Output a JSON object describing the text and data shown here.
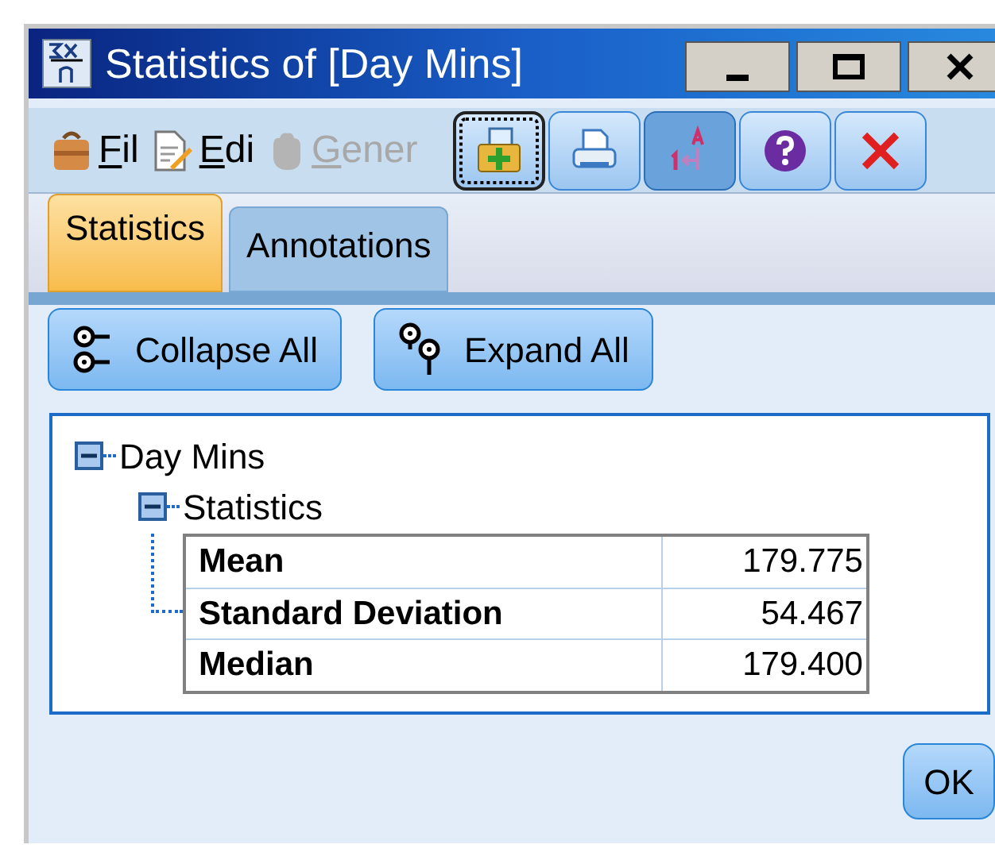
{
  "window": {
    "title": "Statistics of [Day Mins]",
    "controls": [
      {
        "kind": "minimize"
      },
      {
        "kind": "maximize"
      },
      {
        "kind": "close"
      }
    ]
  },
  "menu": [
    {
      "label": "Fil",
      "kind": "bag",
      "disabled": false
    },
    {
      "label": "Edi",
      "kind": "page",
      "disabled": false
    },
    {
      "label": "Gener",
      "kind": "hand",
      "disabled": true
    }
  ],
  "toolbar": [
    {
      "kind": "add",
      "focused": true,
      "pressed": false
    },
    {
      "kind": "print",
      "focused": false,
      "pressed": false
    },
    {
      "kind": "sort",
      "focused": false,
      "pressed": true
    },
    {
      "kind": "help",
      "focused": false,
      "pressed": false
    },
    {
      "kind": "delete",
      "focused": false,
      "pressed": false
    }
  ],
  "tabs": [
    {
      "label": "Statistics",
      "selected": true
    },
    {
      "label": "Annotations",
      "selected": false
    }
  ],
  "actions": [
    {
      "label": "Collapse All",
      "kind": "collapse"
    },
    {
      "label": "Expand All",
      "kind": "expand"
    }
  ],
  "tree": [
    {
      "label": "Day Mins",
      "expanded": true,
      "children": [
        {
          "label": "Statistics",
          "expanded": true,
          "table": [
            {
              "name": "Mean",
              "value": "179.775"
            },
            {
              "name": "Standard Deviation",
              "value": "54.467"
            },
            {
              "name": "Median",
              "value": "179.400"
            }
          ]
        }
      ]
    }
  ],
  "ok_button": "OK"
}
